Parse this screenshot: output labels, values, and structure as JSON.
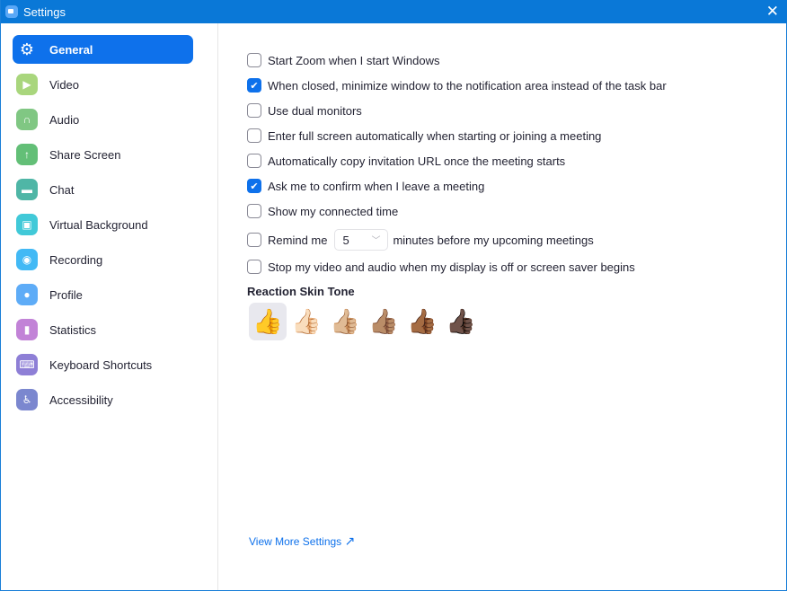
{
  "window": {
    "title": "Settings",
    "close": "✕"
  },
  "sidebar": {
    "items": [
      {
        "label": "General",
        "icon": "gear-icon",
        "color": "#0e71eb",
        "glyph": "⚙"
      },
      {
        "label": "Video",
        "icon": "video-camera-icon",
        "color": "#a9d67d",
        "glyph": "▶"
      },
      {
        "label": "Audio",
        "icon": "headphones-icon",
        "color": "#80c783",
        "glyph": "∩"
      },
      {
        "label": "Share Screen",
        "icon": "share-screen-icon",
        "color": "#63bf77",
        "glyph": "↑"
      },
      {
        "label": "Chat",
        "icon": "chat-icon",
        "color": "#4fb6a6",
        "glyph": "▬"
      },
      {
        "label": "Virtual Background",
        "icon": "virtual-background-icon",
        "color": "#41c9d8",
        "glyph": "▣"
      },
      {
        "label": "Recording",
        "icon": "recording-icon",
        "color": "#42b9f5",
        "glyph": "◉"
      },
      {
        "label": "Profile",
        "icon": "profile-icon",
        "color": "#5eacf7",
        "glyph": "●"
      },
      {
        "label": "Statistics",
        "icon": "statistics-icon",
        "color": "#c283d7",
        "glyph": "▮"
      },
      {
        "label": "Keyboard Shortcuts",
        "icon": "keyboard-icon",
        "color": "#8e7fd6",
        "glyph": "⌨"
      },
      {
        "label": "Accessibility",
        "icon": "accessibility-icon",
        "color": "#7b87cf",
        "glyph": "♿"
      }
    ]
  },
  "general": {
    "options": [
      {
        "label": "Start Zoom when I start Windows",
        "checked": false
      },
      {
        "label": "When closed, minimize window to the notification area instead of the task bar",
        "checked": true
      },
      {
        "label": "Use dual monitors",
        "checked": false
      },
      {
        "label": "Enter full screen automatically when starting or joining a meeting",
        "checked": false
      },
      {
        "label": "Automatically copy invitation URL once the meeting starts",
        "checked": false
      },
      {
        "label": "Ask me to confirm when I leave a meeting",
        "checked": true
      },
      {
        "label": "Show my connected time",
        "checked": false
      }
    ],
    "remind": {
      "label": "Remind me",
      "value": "5",
      "suffix": "minutes before my upcoming meetings",
      "checked": false
    },
    "stop_video": {
      "label": "Stop my video and audio when my display is off or screen saver begins",
      "checked": false
    },
    "skin_tone": {
      "label": "Reaction Skin Tone",
      "tones": [
        "👍",
        "👍🏻",
        "👍🏼",
        "👍🏽",
        "👍🏾",
        "👍🏿"
      ],
      "selected": 0
    },
    "more_link": "View More Settings",
    "more_icon": "↗"
  },
  "accent": "#0e71eb"
}
